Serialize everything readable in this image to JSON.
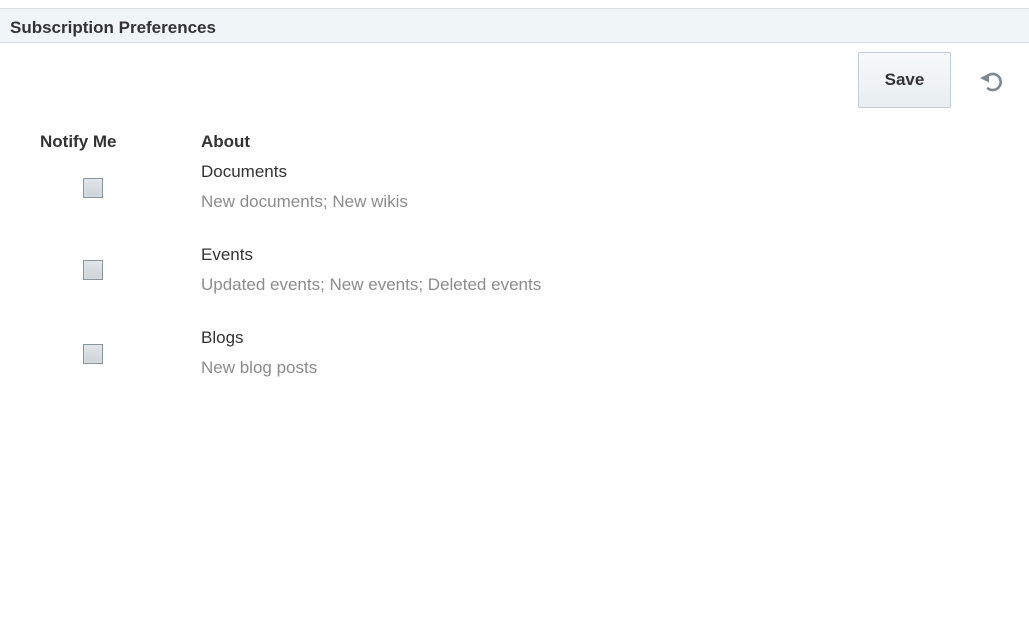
{
  "header": {
    "title": "Subscription Preferences"
  },
  "toolbar": {
    "save_label": "Save",
    "reset_icon": "reset-icon"
  },
  "columns": {
    "notify_me": "Notify Me",
    "about": "About"
  },
  "subscriptions": [
    {
      "title": "Documents",
      "description": "New documents; New wikis",
      "checked": false
    },
    {
      "title": "Events",
      "description": "Updated events; New events; Deleted events",
      "checked": false
    },
    {
      "title": "Blogs",
      "description": "New blog posts",
      "checked": false
    }
  ]
}
